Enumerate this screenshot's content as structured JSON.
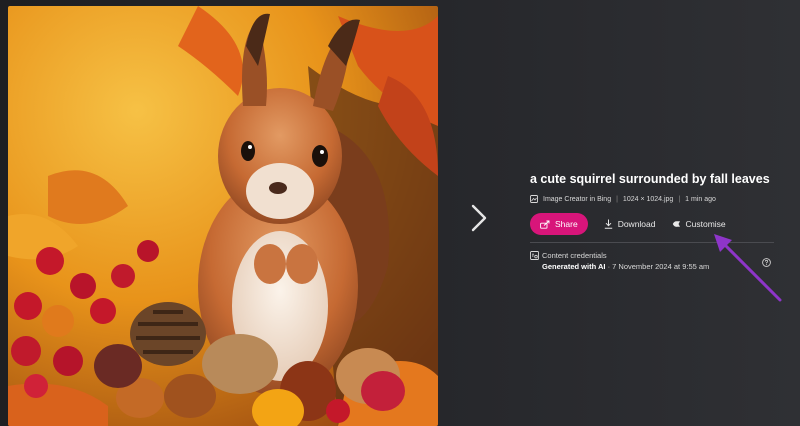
{
  "image": {
    "description_icon": "squirrel-photo"
  },
  "details": {
    "title": "a cute squirrel surrounded by fall leaves",
    "source": "Image Creator in Bing",
    "dimensions": "1024 × 1024.jpg",
    "time": "1 min ago"
  },
  "actions": {
    "share_label": "Share",
    "download_label": "Download",
    "customise_label": "Customise"
  },
  "credentials": {
    "heading": "Content credentials",
    "generated": "Generated with AI",
    "date": "· 7 November 2024 at 9:55 am"
  },
  "colors": {
    "share_button": "#d8157a",
    "annotation_arrow": "#8e35c9"
  }
}
